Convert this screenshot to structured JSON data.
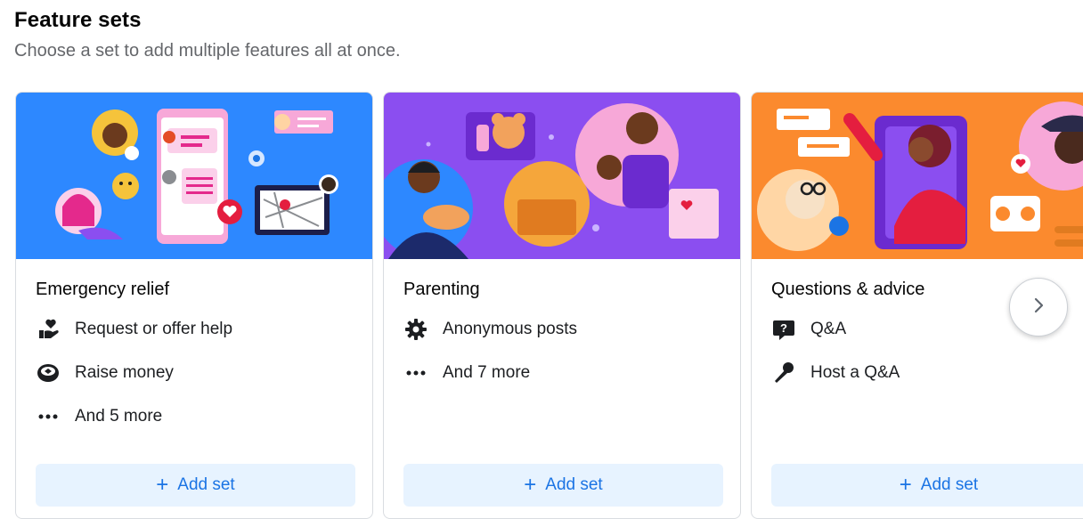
{
  "header": {
    "title": "Feature sets",
    "subtitle": "Choose a set to add multiple features all at once."
  },
  "cards": [
    {
      "title": "Emergency relief",
      "features": [
        {
          "icon": "heart-hand-icon",
          "label": "Request or offer help"
        },
        {
          "icon": "coin-icon",
          "label": "Raise money"
        },
        {
          "icon": "more-dots-icon",
          "label": "And 5 more"
        }
      ],
      "add_label": "Add set",
      "hero_color": "#2d88ff"
    },
    {
      "title": "Parenting",
      "features": [
        {
          "icon": "gear-icon",
          "label": "Anonymous posts"
        },
        {
          "icon": "more-dots-icon",
          "label": "And 7 more"
        }
      ],
      "add_label": "Add set",
      "hero_color": "#8b4ef0"
    },
    {
      "title": "Questions & advice",
      "features": [
        {
          "icon": "question-bubble-icon",
          "label": "Q&A"
        },
        {
          "icon": "microphone-icon",
          "label": "Host a Q&A"
        }
      ],
      "add_label": "Add set",
      "hero_color": "#fb8a2e"
    }
  ],
  "colors": {
    "accent": "#1b74e4",
    "button_bg": "#e7f3ff",
    "subtext": "#65676b"
  }
}
